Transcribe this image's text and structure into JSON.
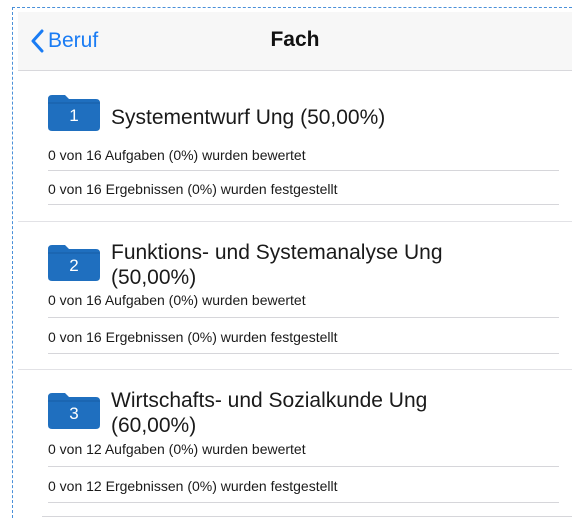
{
  "nav": {
    "back_label": "Beruf",
    "title": "Fach"
  },
  "colors": {
    "accent": "#1a7cf4",
    "folder": "#1f6fbf"
  },
  "sections": [
    {
      "number": "1",
      "title": "Systementwurf Ung (50,00%)",
      "title_line2": "",
      "tasks_text": "0 von 16 Aufgaben (0%) wurden bewertet",
      "results_text": "0 von 16 Ergebnissen (0%) wurden festgestellt"
    },
    {
      "number": "2",
      "title": "Funktions- und Systemanalyse Ung",
      "title_line2": "(50,00%)",
      "tasks_text": "0 von 16 Aufgaben (0%) wurden bewertet",
      "results_text": "0 von 16 Ergebnissen (0%) wurden festgestellt"
    },
    {
      "number": "3",
      "title": "Wirtschafts- und Sozialkunde Ung",
      "title_line2": "(60,00%)",
      "tasks_text": "0 von 12 Aufgaben (0%) wurden bewertet",
      "results_text": "0 von 12 Ergebnissen (0%) wurden festgestellt"
    }
  ]
}
